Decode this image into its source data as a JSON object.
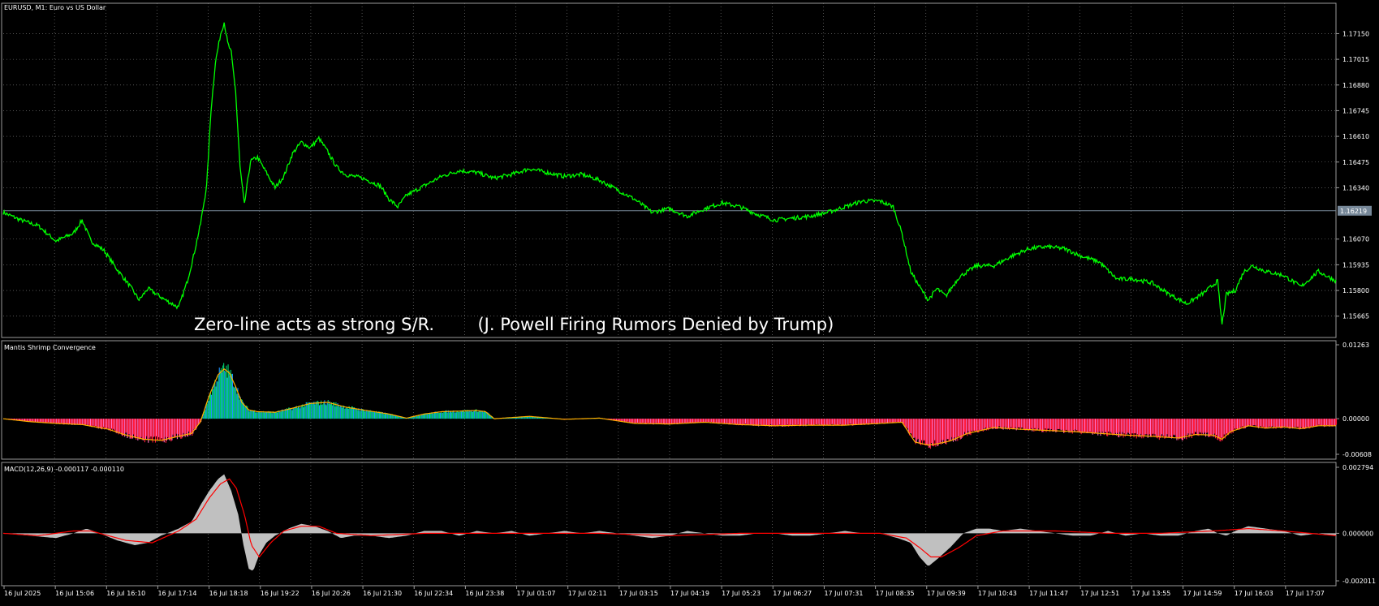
{
  "window": {
    "symbol_label": "EURUSD, M1:  Euro vs US Dollar",
    "annotation": "Zero-line acts as strong S/R.        (J. Powell Firing Rumors Denied by Trump)"
  },
  "colors": {
    "background": "#000000",
    "grid": "#8a8a8a",
    "frame": "#9a9a9a",
    "price_line": "#00ff00",
    "current_price_line": "#778899",
    "msc_positive_green": "#00d070",
    "msc_positive_blue": "#1e90ff",
    "msc_negative_red": "#ff1a3a",
    "msc_negative_pink": "#ff6ec7",
    "msc_signal": "#ffb000",
    "macd_histogram": "#c0c0c0",
    "macd_signal": "#ff0000"
  },
  "time_axis": {
    "labels": [
      "16 Jul 2025",
      "16 Jul 15:06",
      "16 Jul 16:10",
      "16 Jul 17:14",
      "16 Jul 18:18",
      "16 Jul 19:22",
      "16 Jul 20:26",
      "16 Jul 21:30",
      "16 Jul 22:34",
      "16 Jul 23:38",
      "17 Jul 01:07",
      "17 Jul 02:11",
      "17 Jul 03:15",
      "17 Jul 04:19",
      "17 Jul 05:23",
      "17 Jul 06:27",
      "17 Jul 07:31",
      "17 Jul 08:35",
      "17 Jul 09:39",
      "17 Jul 10:43",
      "17 Jul 11:47",
      "17 Jul 12:51",
      "17 Jul 13:55",
      "17 Jul 14:59",
      "17 Jul 16:03",
      "17 Jul 17:07"
    ]
  },
  "chart_data": [
    {
      "type": "line",
      "name": "EURUSD, M1",
      "price_ticks": [
        "1.17150",
        "1.17015",
        "1.16880",
        "1.16745",
        "1.16610",
        "1.16475",
        "1.16340",
        "1.16070",
        "1.15935",
        "1.15800",
        "1.15665"
      ],
      "current_price": "1.16219",
      "ylim": [
        1.1557,
        1.1725
      ],
      "x_index_range": [
        0,
        1520
      ],
      "series": [
        {
          "x": [
            0,
            20,
            40,
            60,
            80,
            90,
            100,
            115,
            130,
            145,
            155,
            165,
            175,
            185,
            200,
            210,
            217,
            225,
            232,
            237,
            242,
            248,
            252,
            256,
            260,
            265,
            270,
            275,
            282,
            290,
            300,
            310,
            320,
            330,
            340,
            350,
            360,
            370,
            380,
            390,
            410,
            430,
            440,
            450,
            460,
            480,
            500,
            520,
            540,
            560,
            580,
            600,
            620,
            640,
            660,
            680,
            700,
            720,
            740,
            760,
            780,
            800,
            820,
            840,
            860,
            880,
            900,
            920,
            940,
            960,
            980,
            1000,
            1015,
            1025,
            1035,
            1045,
            1055,
            1065,
            1075,
            1090,
            1110,
            1130,
            1150,
            1170,
            1190,
            1210,
            1230,
            1250,
            1270,
            1290,
            1310,
            1330,
            1350,
            1370,
            1385,
            1390,
            1395,
            1405,
            1415,
            1425,
            1440,
            1460,
            1480,
            1500,
            1520
          ],
          "y": [
            1.1621,
            1.1617,
            1.1614,
            1.1606,
            1.161,
            1.1617,
            1.1606,
            1.1601,
            1.1591,
            1.1582,
            1.1575,
            1.1581,
            1.1578,
            1.1575,
            1.1571,
            1.1585,
            1.1598,
            1.1615,
            1.1635,
            1.1675,
            1.17,
            1.1715,
            1.1721,
            1.171,
            1.1705,
            1.1685,
            1.1645,
            1.1625,
            1.1648,
            1.165,
            1.1642,
            1.1634,
            1.164,
            1.1652,
            1.1658,
            1.1655,
            1.166,
            1.1653,
            1.1645,
            1.1641,
            1.1639,
            1.1635,
            1.1628,
            1.1624,
            1.163,
            1.1635,
            1.164,
            1.1643,
            1.1642,
            1.1639,
            1.1641,
            1.1644,
            1.1642,
            1.164,
            1.1641,
            1.1638,
            1.1633,
            1.1628,
            1.1621,
            1.1623,
            1.1619,
            1.1623,
            1.1626,
            1.1624,
            1.162,
            1.1617,
            1.1618,
            1.1619,
            1.1621,
            1.1624,
            1.1627,
            1.1627,
            1.1624,
            1.161,
            1.159,
            1.1582,
            1.1575,
            1.1581,
            1.1577,
            1.1587,
            1.1593,
            1.1593,
            1.1598,
            1.1602,
            1.1603,
            1.1602,
            1.1598,
            1.1595,
            1.1586,
            1.1586,
            1.1584,
            1.1578,
            1.1573,
            1.1579,
            1.1585,
            1.1562,
            1.1578,
            1.158,
            1.159,
            1.1593,
            1.159,
            1.1588,
            1.1582,
            1.159,
            1.1585
          ]
        }
      ]
    },
    {
      "type": "bar",
      "name": "Mantis Shrimp Convergence",
      "title": "Mantis Shrimp Convergence",
      "ticks": [
        "0.01263",
        "0.00000",
        "-0.00608"
      ],
      "ylim": [
        -0.00608,
        0.01263
      ],
      "x_index_range": [
        0,
        1520
      ],
      "series": [
        {
          "x": [
            0,
            30,
            60,
            90,
            120,
            140,
            160,
            180,
            200,
            215,
            225,
            235,
            245,
            252,
            258,
            265,
            272,
            280,
            290,
            310,
            330,
            350,
            370,
            390,
            410,
            440,
            460,
            480,
            500,
            520,
            540,
            550,
            560,
            600,
            640,
            680,
            720,
            760,
            800,
            840,
            880,
            920,
            960,
            1000,
            1025,
            1040,
            1055,
            1065,
            1080,
            1100,
            1130,
            1160,
            1190,
            1220,
            1250,
            1280,
            1310,
            1340,
            1360,
            1380,
            1390,
            1400,
            1420,
            1440,
            1460,
            1480,
            1500,
            1520
          ],
          "values": [
            0.0,
            -0.0005,
            -0.0008,
            -0.001,
            -0.0018,
            -0.0028,
            -0.0035,
            -0.0037,
            -0.003,
            -0.0025,
            -0.0005,
            0.004,
            0.0075,
            0.0085,
            0.0078,
            0.0055,
            0.0028,
            0.0015,
            0.0012,
            0.0011,
            0.0018,
            0.0026,
            0.0028,
            0.002,
            0.0015,
            0.0008,
            0.0001,
            0.0008,
            0.0012,
            0.0013,
            0.0014,
            0.0012,
            0.0,
            0.0004,
            -0.0001,
            0.0001,
            -0.0008,
            -0.0009,
            -0.0006,
            -0.001,
            -0.0012,
            -0.0011,
            -0.0011,
            -0.0008,
            -0.0006,
            -0.004,
            -0.0045,
            -0.0043,
            -0.0038,
            -0.0025,
            -0.0015,
            -0.0018,
            -0.002,
            -0.0022,
            -0.0025,
            -0.0028,
            -0.003,
            -0.0033,
            -0.0027,
            -0.0028,
            -0.0035,
            -0.0022,
            -0.0012,
            -0.0016,
            -0.0014,
            -0.0017,
            -0.0012,
            -0.0012
          ]
        }
      ]
    },
    {
      "type": "area",
      "name": "MACD",
      "title": "MACD(12,26,9) -0.000117 -0.000110",
      "ticks": [
        "0.002794",
        "0.000000",
        "-0.002011"
      ],
      "ylim": [
        -0.002011,
        0.002794
      ],
      "x_index_range": [
        0,
        1520
      ],
      "series": [
        {
          "name": "MACD",
          "x": [
            0,
            30,
            60,
            80,
            95,
            110,
            130,
            150,
            165,
            180,
            200,
            215,
            225,
            235,
            245,
            252,
            260,
            268,
            274,
            280,
            285,
            292,
            300,
            310,
            325,
            340,
            355,
            370,
            385,
            400,
            420,
            440,
            460,
            480,
            500,
            520,
            540,
            560,
            580,
            600,
            620,
            640,
            660,
            680,
            700,
            720,
            740,
            760,
            780,
            800,
            820,
            840,
            860,
            880,
            900,
            920,
            940,
            960,
            980,
            1000,
            1020,
            1035,
            1045,
            1055,
            1065,
            1080,
            1095,
            1110,
            1125,
            1140,
            1160,
            1180,
            1200,
            1220,
            1240,
            1260,
            1280,
            1300,
            1320,
            1340,
            1360,
            1375,
            1385,
            1395,
            1405,
            1420,
            1440,
            1460,
            1480,
            1500,
            1520
          ],
          "values": [
            0.0,
            -0.0001,
            -0.0002,
            0.0,
            0.0002,
            0.0,
            -0.0003,
            -0.0005,
            -0.0004,
            -0.0001,
            0.0002,
            0.0005,
            0.0012,
            0.0018,
            0.0023,
            0.0025,
            0.0018,
            0.0008,
            -0.0005,
            -0.0015,
            -0.0016,
            -0.0009,
            -0.0004,
            -0.0001,
            0.0002,
            0.0004,
            0.0003,
            0.0001,
            -0.0002,
            -0.0001,
            -0.0001,
            -0.0002,
            -0.0001,
            0.0001,
            0.0001,
            -0.0001,
            0.0001,
            0.0,
            0.0001,
            -0.0001,
            0.0,
            0.0001,
            0.0,
            0.0001,
            0.0,
            -0.0001,
            -0.0002,
            -0.0001,
            0.0001,
            0.0,
            -0.0001,
            -0.0001,
            0.0,
            0.0,
            -0.0001,
            -0.0001,
            0.0,
            0.0001,
            0.0,
            0.0,
            -0.0002,
            -0.0004,
            -0.001,
            -0.0014,
            -0.0011,
            -0.0006,
            0.0,
            0.0002,
            0.0002,
            0.0001,
            0.0002,
            0.0001,
            0.0,
            -0.0001,
            -0.0001,
            0.0001,
            -0.0001,
            0.0,
            -0.0001,
            -0.0001,
            0.0001,
            0.0002,
            0.0,
            -0.0001,
            0.0001,
            0.0003,
            0.0002,
            0.0001,
            -0.0001,
            0.0,
            -0.0001
          ]
        },
        {
          "name": "Signal",
          "x": [
            0,
            40,
            80,
            100,
            140,
            170,
            200,
            220,
            235,
            248,
            258,
            266,
            275,
            283,
            292,
            305,
            320,
            340,
            360,
            380,
            420,
            480,
            540,
            600,
            680,
            760,
            840,
            920,
            1000,
            1030,
            1045,
            1058,
            1070,
            1090,
            1110,
            1140,
            1200,
            1260,
            1320,
            1380,
            1420,
            1460,
            1520
          ],
          "values": [
            0.0,
            -0.0001,
            0.0001,
            0.0001,
            -0.0003,
            -0.0004,
            0.0001,
            0.0006,
            0.0015,
            0.0021,
            0.0023,
            0.0019,
            0.0008,
            -0.0005,
            -0.001,
            -0.0004,
            0.0001,
            0.0003,
            0.0003,
            0.0,
            -0.0001,
            0.0,
            0.0,
            0.0,
            0.0,
            -0.0001,
            0.0,
            0.0,
            0.0,
            -0.0002,
            -0.0006,
            -0.001,
            -0.001,
            -0.0006,
            -0.0001,
            0.0001,
            0.0001,
            0.0,
            0.0,
            0.0001,
            0.0002,
            0.0001,
            -0.0001
          ]
        }
      ]
    }
  ]
}
